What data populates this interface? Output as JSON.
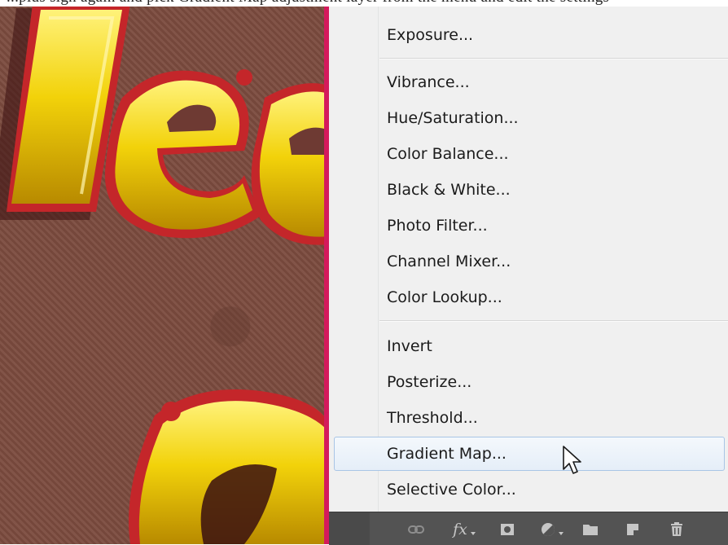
{
  "caption_fragment": "...plus sign again and pick Gradient Map adjustment layer from the menu and edit the settings",
  "menu": {
    "items": [
      {
        "label": "Exposure..."
      },
      {
        "label": "Vibrance..."
      },
      {
        "label": "Hue/Saturation..."
      },
      {
        "label": "Color Balance..."
      },
      {
        "label": "Black & White..."
      },
      {
        "label": "Photo Filter..."
      },
      {
        "label": "Channel Mixer..."
      },
      {
        "label": "Color Lookup..."
      },
      {
        "label": "Invert"
      },
      {
        "label": "Posterize..."
      },
      {
        "label": "Threshold..."
      },
      {
        "label": "Gradient Map..."
      },
      {
        "label": "Selective Color..."
      }
    ],
    "highlighted": "Gradient Map..."
  },
  "toolbar": {
    "icons": [
      "link-icon",
      "fx-icon",
      "layer-mask-icon",
      "adjustment-layer-icon",
      "folder-icon",
      "new-layer-icon",
      "trash-icon"
    ],
    "fx_label": "fx"
  },
  "colors": {
    "canvas_border": "#d41a5c",
    "menu_bg": "#f0f0f0",
    "highlight_border": "#a9c5e6",
    "toolbar_bg": "#535353",
    "gold": "#f2d20a",
    "red_outline": "#c4262a"
  }
}
